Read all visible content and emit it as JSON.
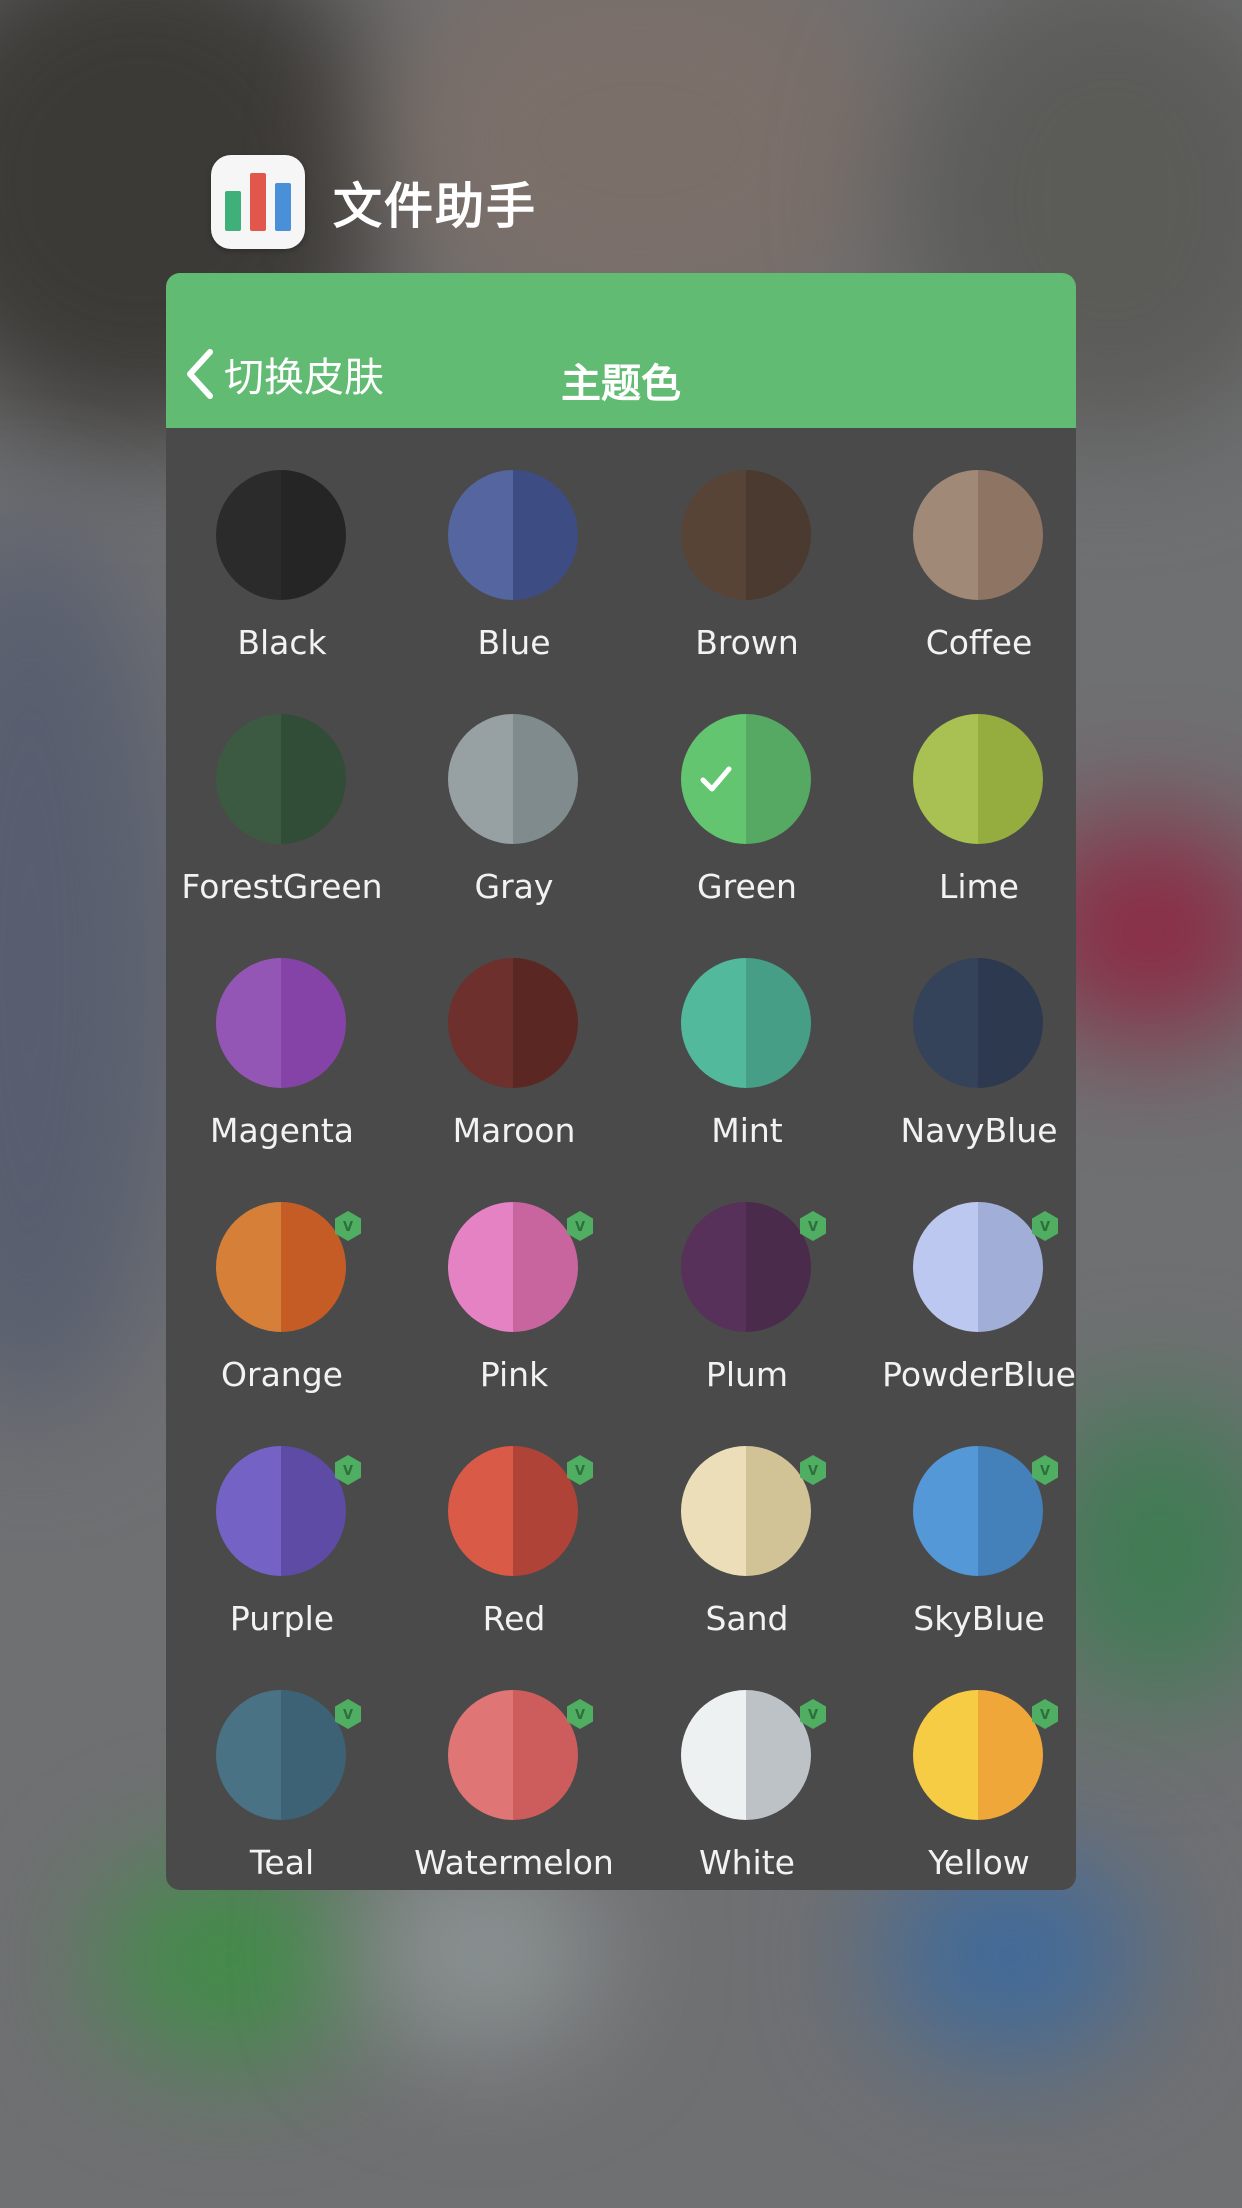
{
  "app": {
    "name": "文件助手",
    "accent": "#61bb72"
  },
  "navbar": {
    "back_label": "切换皮肤",
    "title": "主题色"
  },
  "themes": [
    {
      "name": "Black",
      "left": "#2b2b2b",
      "right": "#252525",
      "selected": false,
      "vip": false
    },
    {
      "name": "Blue",
      "left": "#55659f",
      "right": "#3d4d83",
      "selected": false,
      "vip": false
    },
    {
      "name": "Brown",
      "left": "#574437",
      "right": "#4a3a2f",
      "selected": false,
      "vip": false
    },
    {
      "name": "Coffee",
      "left": "#a18977",
      "right": "#8e7563",
      "selected": false,
      "vip": false
    },
    {
      "name": "ForestGreen",
      "left": "#3b5a41",
      "right": "#324d37",
      "selected": false,
      "vip": false
    },
    {
      "name": "Gray",
      "left": "#97a0a2",
      "right": "#7f8b8d",
      "selected": false,
      "vip": false
    },
    {
      "name": "Green",
      "left": "#64c571",
      "right": "#55a962",
      "selected": true,
      "vip": false
    },
    {
      "name": "Lime",
      "left": "#a8c152",
      "right": "#94ad3e",
      "selected": false,
      "vip": false
    },
    {
      "name": "Magenta",
      "left": "#9456b4",
      "right": "#8543a8",
      "selected": false,
      "vip": false
    },
    {
      "name": "Maroon",
      "left": "#6d302c",
      "right": "#5b2722",
      "selected": false,
      "vip": false
    },
    {
      "name": "Mint",
      "left": "#53b99c",
      "right": "#469e87",
      "selected": false,
      "vip": false
    },
    {
      "name": "NavyBlue",
      "left": "#35435a",
      "right": "#2d394e",
      "selected": false,
      "vip": false
    },
    {
      "name": "Orange",
      "left": "#d67f39",
      "right": "#c65c25",
      "selected": false,
      "vip": true
    },
    {
      "name": "Pink",
      "left": "#e582c3",
      "right": "#c8649e",
      "selected": false,
      "vip": true
    },
    {
      "name": "Plum",
      "left": "#573159",
      "right": "#4a2b4c",
      "selected": false,
      "vip": true
    },
    {
      "name": "PowderBlue",
      "left": "#bcc8ef",
      "right": "#a0aed8",
      "selected": false,
      "vip": true
    },
    {
      "name": "Purple",
      "left": "#7462c4",
      "right": "#5d4ba6",
      "selected": false,
      "vip": true
    },
    {
      "name": "Red",
      "left": "#d95a47",
      "right": "#b04337",
      "selected": false,
      "vip": true
    },
    {
      "name": "Sand",
      "left": "#ecdeb8",
      "right": "#d2c397",
      "selected": false,
      "vip": true
    },
    {
      "name": "SkyBlue",
      "left": "#5598d8",
      "right": "#4480b9",
      "selected": false,
      "vip": true
    },
    {
      "name": "Teal",
      "left": "#497285",
      "right": "#3e6275",
      "selected": false,
      "vip": true
    },
    {
      "name": "Watermelon",
      "left": "#e07575",
      "right": "#cc5d5c",
      "selected": false,
      "vip": true
    },
    {
      "name": "White",
      "left": "#eef1f2",
      "right": "#bcc2c6",
      "selected": false,
      "vip": true
    },
    {
      "name": "Yellow",
      "left": "#f5cc44",
      "right": "#f0a73a",
      "selected": false,
      "vip": true
    }
  ]
}
